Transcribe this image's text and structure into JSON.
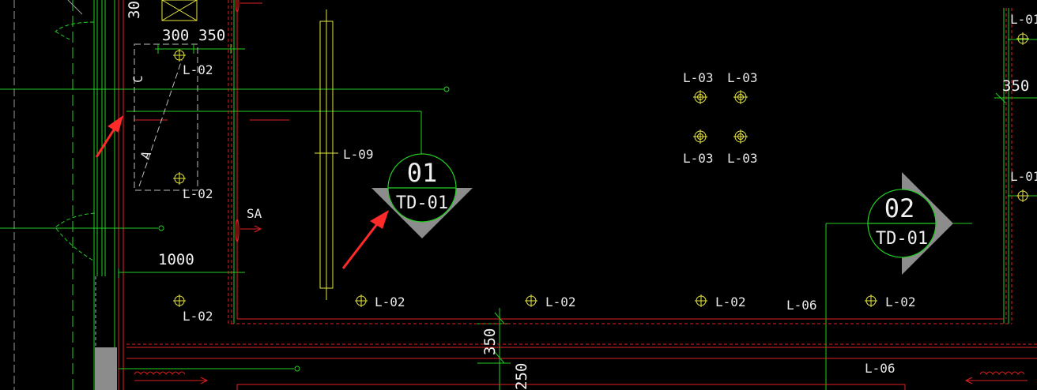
{
  "canvas": {
    "background": "#000000",
    "colors": {
      "green": "#22d022",
      "red": "#e02020",
      "yellow": "#e6e640",
      "white": "#e8e8e8",
      "gray": "#8c8c8c"
    }
  },
  "dimensions": {
    "top_left_partial": "30",
    "d300": "300",
    "d350_top": "350",
    "d1000": "1000",
    "right_350": "350",
    "bottom_350": "350",
    "bottom_250": "250"
  },
  "labels": {
    "l02_a": "L-02",
    "l02_b": "L-02",
    "l02_c": "L-02",
    "l02_d": "L-02",
    "l02_e": "L-02",
    "l02_f": "L-02",
    "l02_g": "L-02",
    "l03_tl": "L-03",
    "l03_tr": "L-03",
    "l03_bl": "L-03",
    "l03_br": "L-03",
    "l09": "L-09",
    "l06_a": "L-06",
    "l06_b": "L-06",
    "l01_top": "L-01",
    "l01_mid": "L-01",
    "sa": "SA",
    "c_mark": "C",
    "a_mark": "A"
  },
  "section_markers": [
    {
      "number": "01",
      "sheet": "TD-01"
    },
    {
      "number": "02",
      "sheet": "TD-01"
    }
  ],
  "annotation_arrows": [
    {
      "color": "#ff2a2a",
      "target": "column line"
    },
    {
      "color": "#ff2a2a",
      "target": "section marker 01"
    }
  ]
}
